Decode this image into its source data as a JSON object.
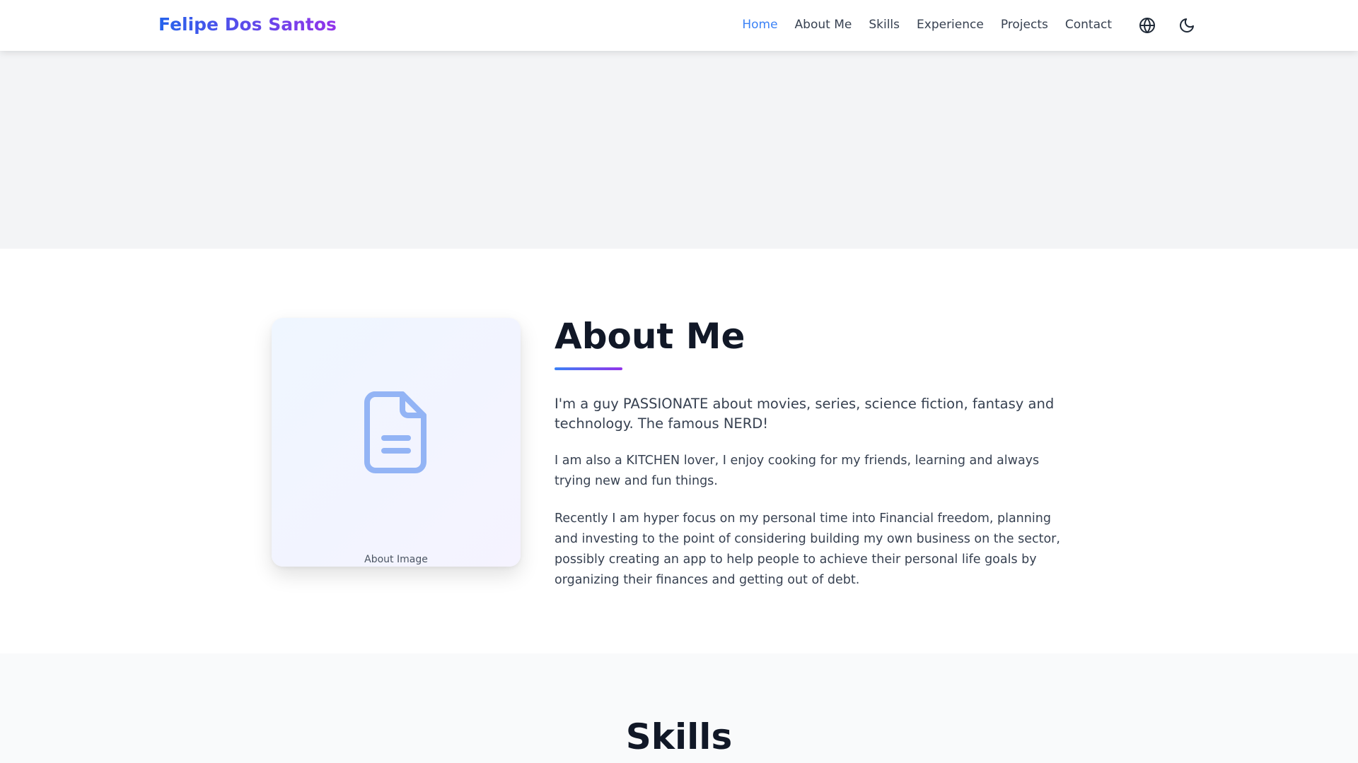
{
  "nav": {
    "brand": "Felipe Dos Santos",
    "links": [
      {
        "label": "Home",
        "active": true
      },
      {
        "label": "About Me",
        "active": false
      },
      {
        "label": "Skills",
        "active": false
      },
      {
        "label": "Experience",
        "active": false
      },
      {
        "label": "Projects",
        "active": false
      },
      {
        "label": "Contact",
        "active": false
      }
    ],
    "icons": [
      "globe-icon",
      "moon-icon"
    ]
  },
  "about": {
    "title": "About Me",
    "image_label": "About Image",
    "image_icon": "document-icon",
    "lead": "I'm a guy PASSIONATE about movies, series, science fiction, fantasy and technology. The famous NERD!",
    "paragraph_1": "I am also a KITCHEN lover, I enjoy cooking for my friends, learning and always trying new and fun things.",
    "paragraph_2": "Recently I am hyper focus on my personal time into Financial freedom, planning and investing to the point of considering building my own business on the sector, possibly creating an app to help people to achieve their personal life goals by organizing their finances and getting out of debt."
  },
  "skills": {
    "title": "Skills"
  },
  "colors": {
    "accent": "#3b82f6",
    "brand_gradient_start": "#2563eb",
    "brand_gradient_end": "#9333ea"
  }
}
